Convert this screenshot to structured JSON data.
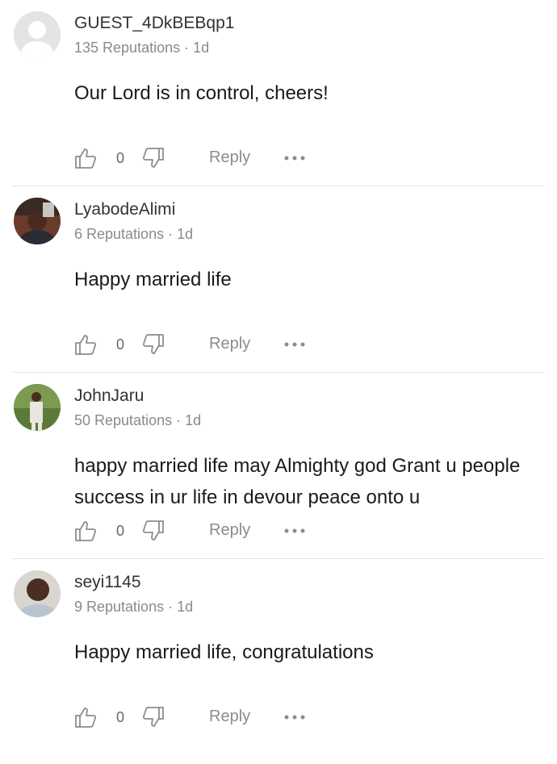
{
  "comments": [
    {
      "author": "GUEST_4DkBEBqp1",
      "reputation": "135 Reputations",
      "time": "1d",
      "text": "Our Lord is in control, cheers!",
      "likes": "0",
      "reply": "Reply",
      "avatar": "default-avatar"
    },
    {
      "author": "LyabodeAlimi",
      "reputation": "6 Reputations",
      "time": "1d",
      "text": "Happy married life",
      "likes": "0",
      "reply": "Reply",
      "avatar": "photo-avatar"
    },
    {
      "author": "JohnJaru",
      "reputation": "50 Reputations",
      "time": "1d",
      "text": "happy married life may Almighty god Grant u people success in ur life in devour peace onto u",
      "likes": "0",
      "reply": "Reply",
      "avatar": "photo-avatar"
    },
    {
      "author": "seyi1145",
      "reputation": "9 Reputations",
      "time": "1d",
      "text": "Happy married life, congratulations",
      "likes": "0",
      "reply": "Reply",
      "avatar": "photo-avatar"
    }
  ],
  "icons": {
    "like": "thumbs-up-icon",
    "dislike": "thumbs-down-icon",
    "more": "more-dots-icon"
  },
  "colors": {
    "meta": "#8a8a8a",
    "divider": "#e3e3e3",
    "icon": "#8c8c8c"
  }
}
